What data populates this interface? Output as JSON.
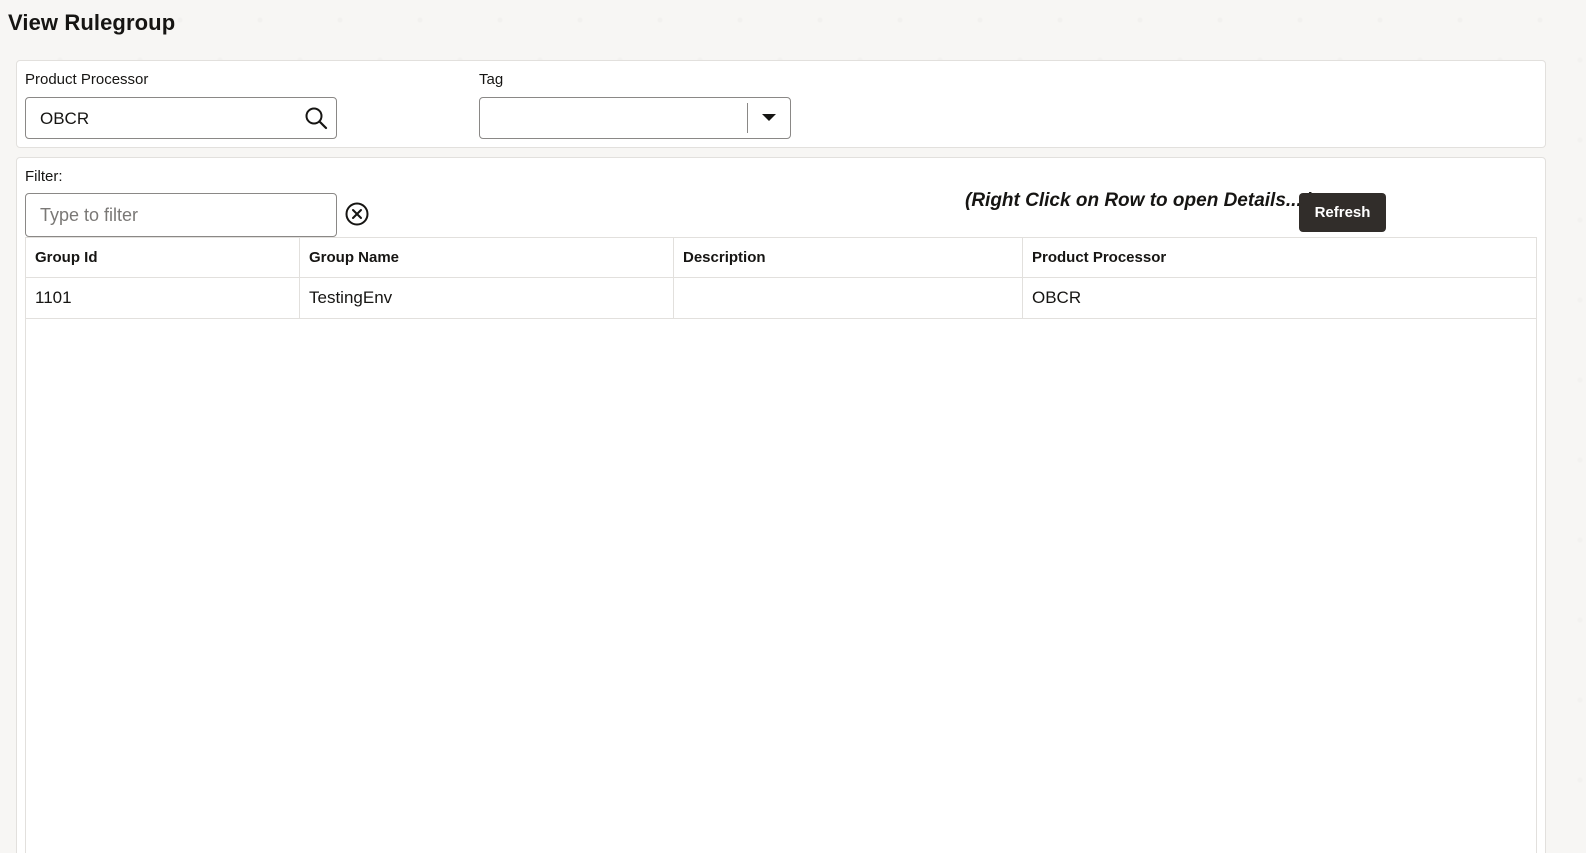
{
  "page": {
    "title": "View Rulegroup"
  },
  "criteria": {
    "product_processor_label": "Product Processor",
    "product_processor_value": "OBCR",
    "tag_label": "Tag",
    "tag_value": ""
  },
  "filter": {
    "label": "Filter:",
    "placeholder": "Type to filter",
    "value": ""
  },
  "hint": "(Right Click on Row to open Details....)",
  "refresh_label": "Refresh",
  "table": {
    "columns": [
      "Group Id",
      "Group Name",
      "Description",
      "Product Processor"
    ],
    "rows": [
      [
        "1101",
        "TestingEnv",
        "",
        "OBCR"
      ]
    ]
  },
  "icons": {
    "search": "search-icon",
    "clear": "clear-circle-icon",
    "dropdown": "caret-down-icon"
  },
  "colors": {
    "button_bg": "#312d2a",
    "button_text": "#ffffff",
    "border": "#8a8886"
  }
}
